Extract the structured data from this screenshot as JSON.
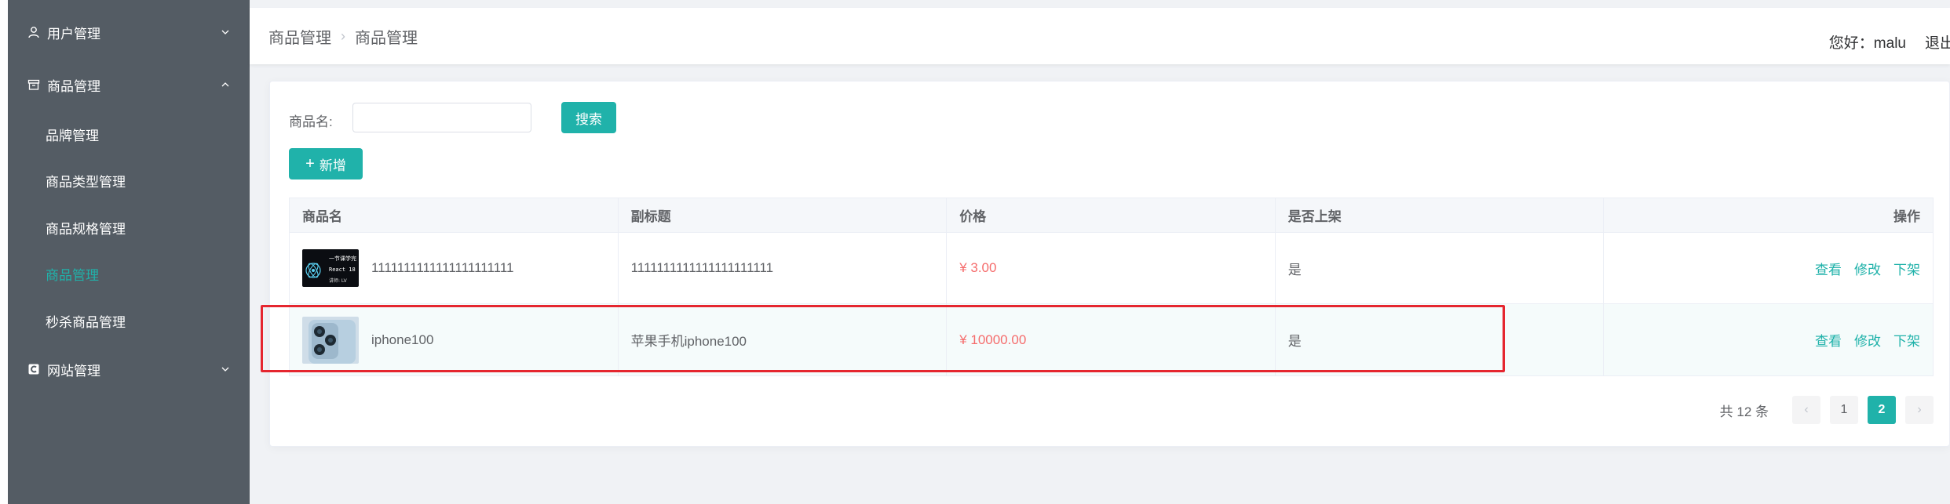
{
  "sidebar": {
    "menus": [
      {
        "label": "用户管理",
        "icon": "user-icon",
        "expanded": false
      },
      {
        "label": "商品管理",
        "icon": "box-icon",
        "expanded": true
      },
      {
        "label": "网站管理",
        "icon": "site-icon",
        "expanded": false
      }
    ],
    "submenu": [
      {
        "label": "品牌管理",
        "active": false
      },
      {
        "label": "商品类型管理",
        "active": false
      },
      {
        "label": "商品规格管理",
        "active": false
      },
      {
        "label": "商品管理",
        "active": true
      },
      {
        "label": "秒杀商品管理",
        "active": false
      }
    ]
  },
  "header": {
    "breadcrumb": [
      "商品管理",
      "商品管理"
    ],
    "greeting": "您好：malu",
    "logout": "退出"
  },
  "search": {
    "label": "商品名:",
    "value": "",
    "placeholder": "",
    "button": "搜索"
  },
  "toolbar": {
    "add_label": "新增"
  },
  "table": {
    "columns": [
      "商品名",
      "副标题",
      "价格",
      "是否上架",
      "操作"
    ],
    "rows": [
      {
        "name": "1111111111111111111111",
        "subtitle": "1111111111111111111111",
        "price": "¥ 3.00",
        "on_shelf": "是",
        "image": "react-course-thumbnail",
        "thumb_text": [
          "一节课学完",
          "React 18",
          "讲师: LV"
        ],
        "actions": [
          "查看",
          "修改",
          "下架"
        ]
      },
      {
        "name": "iphone100",
        "subtitle": "苹果手机iphone100",
        "price": "¥ 10000.00",
        "on_shelf": "是",
        "image": "iphone-camera-thumbnail",
        "actions": [
          "查看",
          "修改",
          "下架"
        ]
      }
    ]
  },
  "pagination": {
    "total_text": "共 12 条",
    "pages": [
      "1",
      "2"
    ],
    "current": "2",
    "prev": "‹",
    "next": "›"
  },
  "colors": {
    "accent": "#20b2aa",
    "sidebar_bg": "#545c64",
    "price": "#f56c6c",
    "highlight": "#e5262f"
  }
}
